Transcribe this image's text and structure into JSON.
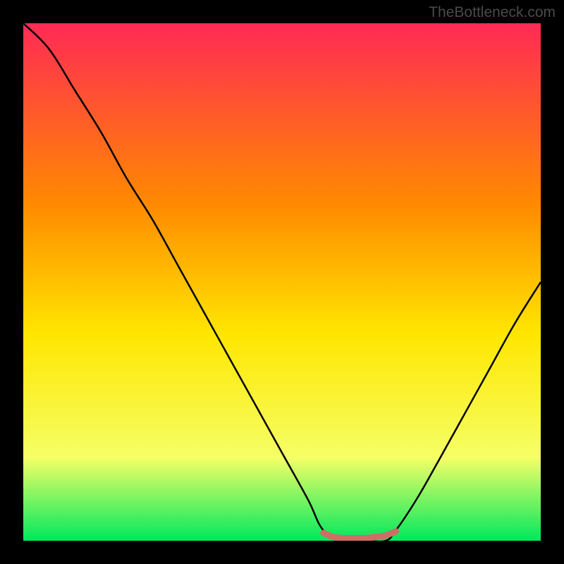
{
  "watermark": "TheBottleneck.com",
  "chart_data": {
    "type": "line",
    "title": "",
    "xlabel": "",
    "ylabel": "",
    "xlim": [
      0,
      100
    ],
    "ylim": [
      0,
      100
    ],
    "gradient_colors": {
      "top": "#ff2a55",
      "mid1": "#ff8a00",
      "mid2": "#ffe600",
      "mid3": "#f5ff66",
      "bottom": "#00e85e"
    },
    "series": [
      {
        "name": "bottleneck-curve",
        "color": "#000000",
        "x": [
          0,
          5,
          10,
          15,
          20,
          25,
          30,
          35,
          40,
          45,
          50,
          55,
          58,
          62,
          66,
          70,
          72,
          76,
          80,
          85,
          90,
          95,
          100
        ],
        "y": [
          100,
          95,
          87,
          79,
          70,
          62,
          53,
          44,
          35,
          26,
          17,
          8,
          2,
          0,
          0,
          0,
          2,
          8,
          15,
          24,
          33,
          42,
          50
        ]
      },
      {
        "name": "flat-marker",
        "color": "#cc6f66",
        "x": [
          58,
          60,
          62,
          64,
          66,
          68,
          70,
          72
        ],
        "y": [
          1.5,
          0.7,
          0.5,
          0.5,
          0.5,
          0.7,
          1.0,
          1.8
        ]
      }
    ]
  }
}
